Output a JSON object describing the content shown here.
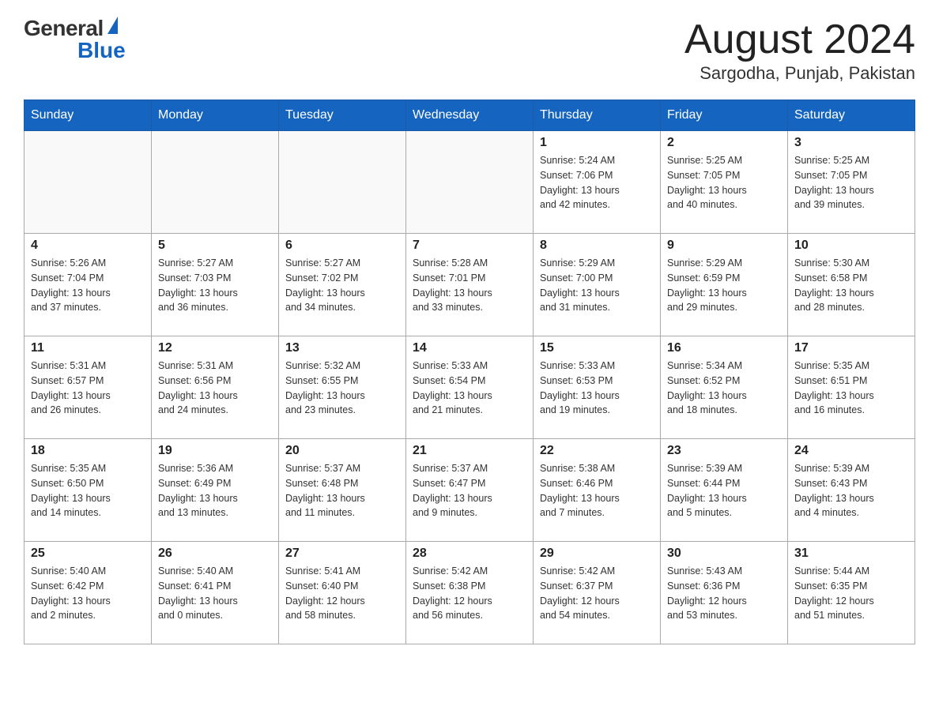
{
  "header": {
    "logo_general": "General",
    "logo_blue": "Blue",
    "month_title": "August 2024",
    "location": "Sargodha, Punjab, Pakistan"
  },
  "days_of_week": [
    "Sunday",
    "Monday",
    "Tuesday",
    "Wednesday",
    "Thursday",
    "Friday",
    "Saturday"
  ],
  "weeks": [
    [
      {
        "day": "",
        "info": ""
      },
      {
        "day": "",
        "info": ""
      },
      {
        "day": "",
        "info": ""
      },
      {
        "day": "",
        "info": ""
      },
      {
        "day": "1",
        "info": "Sunrise: 5:24 AM\nSunset: 7:06 PM\nDaylight: 13 hours\nand 42 minutes."
      },
      {
        "day": "2",
        "info": "Sunrise: 5:25 AM\nSunset: 7:05 PM\nDaylight: 13 hours\nand 40 minutes."
      },
      {
        "day": "3",
        "info": "Sunrise: 5:25 AM\nSunset: 7:05 PM\nDaylight: 13 hours\nand 39 minutes."
      }
    ],
    [
      {
        "day": "4",
        "info": "Sunrise: 5:26 AM\nSunset: 7:04 PM\nDaylight: 13 hours\nand 37 minutes."
      },
      {
        "day": "5",
        "info": "Sunrise: 5:27 AM\nSunset: 7:03 PM\nDaylight: 13 hours\nand 36 minutes."
      },
      {
        "day": "6",
        "info": "Sunrise: 5:27 AM\nSunset: 7:02 PM\nDaylight: 13 hours\nand 34 minutes."
      },
      {
        "day": "7",
        "info": "Sunrise: 5:28 AM\nSunset: 7:01 PM\nDaylight: 13 hours\nand 33 minutes."
      },
      {
        "day": "8",
        "info": "Sunrise: 5:29 AM\nSunset: 7:00 PM\nDaylight: 13 hours\nand 31 minutes."
      },
      {
        "day": "9",
        "info": "Sunrise: 5:29 AM\nSunset: 6:59 PM\nDaylight: 13 hours\nand 29 minutes."
      },
      {
        "day": "10",
        "info": "Sunrise: 5:30 AM\nSunset: 6:58 PM\nDaylight: 13 hours\nand 28 minutes."
      }
    ],
    [
      {
        "day": "11",
        "info": "Sunrise: 5:31 AM\nSunset: 6:57 PM\nDaylight: 13 hours\nand 26 minutes."
      },
      {
        "day": "12",
        "info": "Sunrise: 5:31 AM\nSunset: 6:56 PM\nDaylight: 13 hours\nand 24 minutes."
      },
      {
        "day": "13",
        "info": "Sunrise: 5:32 AM\nSunset: 6:55 PM\nDaylight: 13 hours\nand 23 minutes."
      },
      {
        "day": "14",
        "info": "Sunrise: 5:33 AM\nSunset: 6:54 PM\nDaylight: 13 hours\nand 21 minutes."
      },
      {
        "day": "15",
        "info": "Sunrise: 5:33 AM\nSunset: 6:53 PM\nDaylight: 13 hours\nand 19 minutes."
      },
      {
        "day": "16",
        "info": "Sunrise: 5:34 AM\nSunset: 6:52 PM\nDaylight: 13 hours\nand 18 minutes."
      },
      {
        "day": "17",
        "info": "Sunrise: 5:35 AM\nSunset: 6:51 PM\nDaylight: 13 hours\nand 16 minutes."
      }
    ],
    [
      {
        "day": "18",
        "info": "Sunrise: 5:35 AM\nSunset: 6:50 PM\nDaylight: 13 hours\nand 14 minutes."
      },
      {
        "day": "19",
        "info": "Sunrise: 5:36 AM\nSunset: 6:49 PM\nDaylight: 13 hours\nand 13 minutes."
      },
      {
        "day": "20",
        "info": "Sunrise: 5:37 AM\nSunset: 6:48 PM\nDaylight: 13 hours\nand 11 minutes."
      },
      {
        "day": "21",
        "info": "Sunrise: 5:37 AM\nSunset: 6:47 PM\nDaylight: 13 hours\nand 9 minutes."
      },
      {
        "day": "22",
        "info": "Sunrise: 5:38 AM\nSunset: 6:46 PM\nDaylight: 13 hours\nand 7 minutes."
      },
      {
        "day": "23",
        "info": "Sunrise: 5:39 AM\nSunset: 6:44 PM\nDaylight: 13 hours\nand 5 minutes."
      },
      {
        "day": "24",
        "info": "Sunrise: 5:39 AM\nSunset: 6:43 PM\nDaylight: 13 hours\nand 4 minutes."
      }
    ],
    [
      {
        "day": "25",
        "info": "Sunrise: 5:40 AM\nSunset: 6:42 PM\nDaylight: 13 hours\nand 2 minutes."
      },
      {
        "day": "26",
        "info": "Sunrise: 5:40 AM\nSunset: 6:41 PM\nDaylight: 13 hours\nand 0 minutes."
      },
      {
        "day": "27",
        "info": "Sunrise: 5:41 AM\nSunset: 6:40 PM\nDaylight: 12 hours\nand 58 minutes."
      },
      {
        "day": "28",
        "info": "Sunrise: 5:42 AM\nSunset: 6:38 PM\nDaylight: 12 hours\nand 56 minutes."
      },
      {
        "day": "29",
        "info": "Sunrise: 5:42 AM\nSunset: 6:37 PM\nDaylight: 12 hours\nand 54 minutes."
      },
      {
        "day": "30",
        "info": "Sunrise: 5:43 AM\nSunset: 6:36 PM\nDaylight: 12 hours\nand 53 minutes."
      },
      {
        "day": "31",
        "info": "Sunrise: 5:44 AM\nSunset: 6:35 PM\nDaylight: 12 hours\nand 51 minutes."
      }
    ]
  ]
}
